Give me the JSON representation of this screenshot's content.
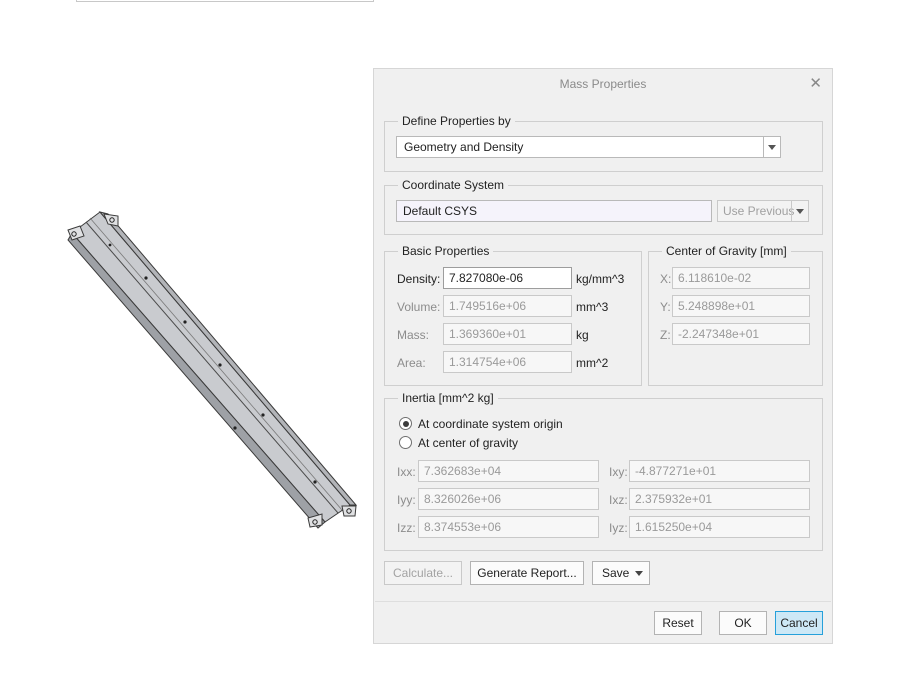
{
  "dialog": {
    "title": "Mass Properties",
    "define_properties": {
      "legend": "Define Properties by",
      "selected": "Geometry and Density"
    },
    "coordinate_system": {
      "legend": "Coordinate System",
      "value": "Default CSYS",
      "use_previous_label": "Use Previous"
    },
    "basic_properties": {
      "legend": "Basic Properties",
      "density": {
        "label": "Density:",
        "value": "7.827080e-06",
        "unit": "kg/mm^3"
      },
      "volume": {
        "label": "Volume:",
        "value": "1.749516e+06",
        "unit": "mm^3"
      },
      "mass": {
        "label": "Mass:",
        "value": "1.369360e+01",
        "unit": "kg"
      },
      "area": {
        "label": "Area:",
        "value": "1.314754e+06",
        "unit": "mm^2"
      }
    },
    "center_of_gravity": {
      "legend": "Center of Gravity [mm]",
      "x": {
        "label": "X:",
        "value": "6.118610e-02"
      },
      "y": {
        "label": "Y:",
        "value": "5.248898e+01"
      },
      "z": {
        "label": "Z:",
        "value": "-2.247348e+01"
      }
    },
    "inertia": {
      "legend": "Inertia [mm^2 kg]",
      "options": [
        {
          "label": "At coordinate system origin",
          "selected": true
        },
        {
          "label": "At center of gravity",
          "selected": false
        }
      ],
      "ixx": {
        "label": "Ixx:",
        "value": "7.362683e+04"
      },
      "iyy": {
        "label": "Iyy:",
        "value": "8.326026e+06"
      },
      "izz": {
        "label": "Izz:",
        "value": "8.374553e+06"
      },
      "ixy": {
        "label": "Ixy:",
        "value": "-4.877271e+01"
      },
      "ixz": {
        "label": "Ixz:",
        "value": "2.375932e+01"
      },
      "iyz": {
        "label": "Iyz:",
        "value": "1.615250e+04"
      }
    },
    "buttons": {
      "calculate": "Calculate...",
      "generate_report": "Generate Report...",
      "save": "Save",
      "reset": "Reset",
      "ok": "OK",
      "cancel": "Cancel"
    }
  }
}
